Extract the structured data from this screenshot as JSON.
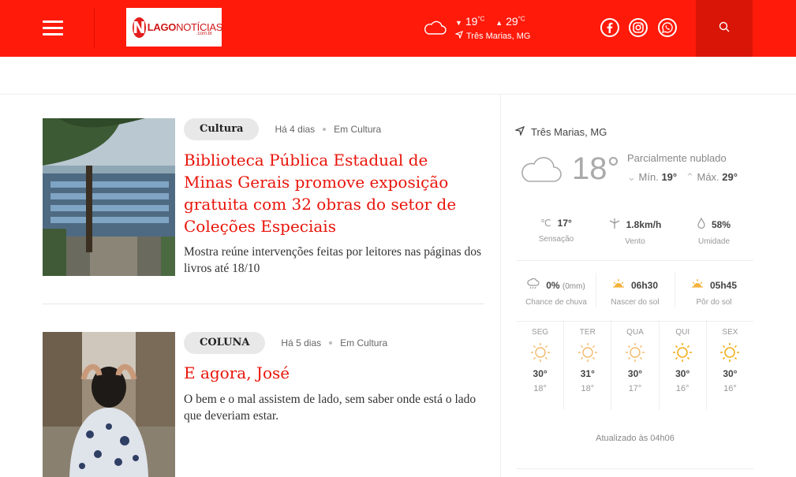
{
  "header": {
    "logo": {
      "letter": "N",
      "text_bold": "LAGO",
      "text_light": "NOTÍCIAS",
      "sub": ".com.br"
    },
    "weather": {
      "min": "19",
      "max": "29",
      "unit": "°C",
      "location": "Três Marias, MG"
    },
    "social": [
      "facebook-icon",
      "instagram-icon",
      "whatsapp-icon"
    ],
    "colors": {
      "primary": "#ff1a0a",
      "search_bg": "#d91508",
      "title": "#e8140a"
    }
  },
  "articles": [
    {
      "tag": "Cultura",
      "date": "Há 4 dias",
      "category": "Em Cultura",
      "title": "Biblioteca Pública Estadual de Minas Gerais promove exposição gratuita com 32 obras do setor de Coleções Especiais",
      "description": "Mostra reúne intervenções feitas por leitores nas páginas dos livros até 18/10"
    },
    {
      "tag": "COLUNA",
      "date": "Há 5 dias",
      "category": "Em Cultura",
      "title": "E agora, José",
      "description": "O bem e o mal assistem de lado, sem saber onde está o lado que deveriam estar."
    }
  ],
  "weather_widget": {
    "location": "Três Marias, MG",
    "temp": "18°",
    "condition": "Parcialmente nublado",
    "min_label": "Mín.",
    "min": "19°",
    "max_label": "Máx.",
    "max": "29°",
    "feels": {
      "value": "17°",
      "label": "Sensação"
    },
    "wind": {
      "value": "1.8km/h",
      "label": "Vento"
    },
    "humidity": {
      "value": "58%",
      "label": "Umidade"
    },
    "rain": {
      "value": "0%",
      "extra": "(0mm)",
      "label": "Chance de chuva"
    },
    "sunrise": {
      "value": "06h30",
      "label": "Nascer do sol"
    },
    "sunset": {
      "value": "05h45",
      "label": "Pôr do sol"
    },
    "forecast": [
      {
        "day": "SEG",
        "hi": "30°",
        "lo": "18°"
      },
      {
        "day": "TER",
        "hi": "31°",
        "lo": "18°"
      },
      {
        "day": "QUA",
        "hi": "30°",
        "lo": "17°"
      },
      {
        "day": "QUI",
        "hi": "30°",
        "lo": "16°"
      },
      {
        "day": "SEX",
        "hi": "30°",
        "lo": "16°"
      }
    ],
    "updated": "Atualizado às 04h06"
  }
}
